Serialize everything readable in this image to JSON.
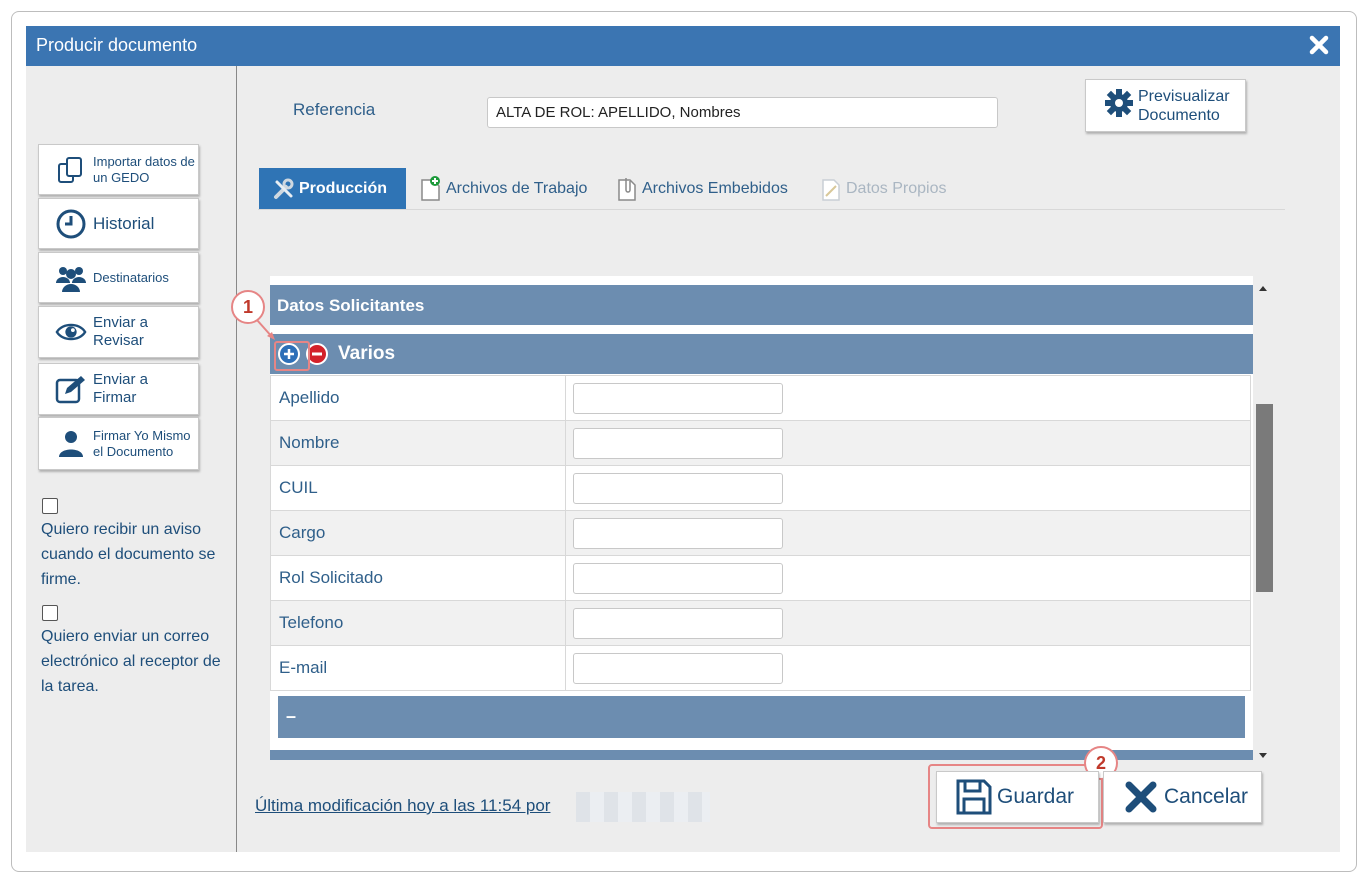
{
  "dialog": {
    "title": "Producir documento"
  },
  "sidebar": {
    "buttons": [
      {
        "label": "Importar datos de un GEDO"
      },
      {
        "label": "Historial"
      },
      {
        "label": "Destinatarios"
      },
      {
        "label": "Enviar a Revisar"
      },
      {
        "label": "Enviar a Firmar"
      },
      {
        "label": "Firmar Yo Mismo el Documento"
      }
    ],
    "checkboxes": [
      {
        "label": "Quiero recibir un aviso cuando el documento se firme.",
        "checked": false
      },
      {
        "label": "Quiero enviar un correo electrónico al receptor de la tarea.",
        "checked": false
      }
    ]
  },
  "header": {
    "reference_label": "Referencia",
    "reference_value": "ALTA DE ROL: APELLIDO, Nombres",
    "preview_button": "Previsualizar Documento"
  },
  "tabs": [
    {
      "label": "Producción",
      "state": "active"
    },
    {
      "label": "Archivos de Trabajo",
      "state": "normal"
    },
    {
      "label": "Archivos Embebidos",
      "state": "normal"
    },
    {
      "label": "Datos Propios",
      "state": "disabled"
    }
  ],
  "form": {
    "section_title": "Datos Solicitantes",
    "group_title": "Varios",
    "fields": [
      {
        "label": "Apellido",
        "value": ""
      },
      {
        "label": "Nombre",
        "value": ""
      },
      {
        "label": "CUIL",
        "value": ""
      },
      {
        "label": "Cargo",
        "value": ""
      },
      {
        "label": "Rol Solicitado",
        "value": ""
      },
      {
        "label": "Telefono",
        "value": ""
      },
      {
        "label": "E-mail",
        "value": ""
      }
    ],
    "sub_header": "–"
  },
  "footer": {
    "last_modified": "Última modificación hoy a las 11:54 por",
    "save_button": "Guardar",
    "cancel_button": "Cancelar"
  },
  "annotations": {
    "badge1": "1",
    "badge2": "2"
  },
  "colors": {
    "titlebar": "#3b75b2",
    "section": "#6c8db0",
    "active_tab": "#2f74b5",
    "text_link": "#1e4e7a",
    "callout": "#e68585"
  }
}
